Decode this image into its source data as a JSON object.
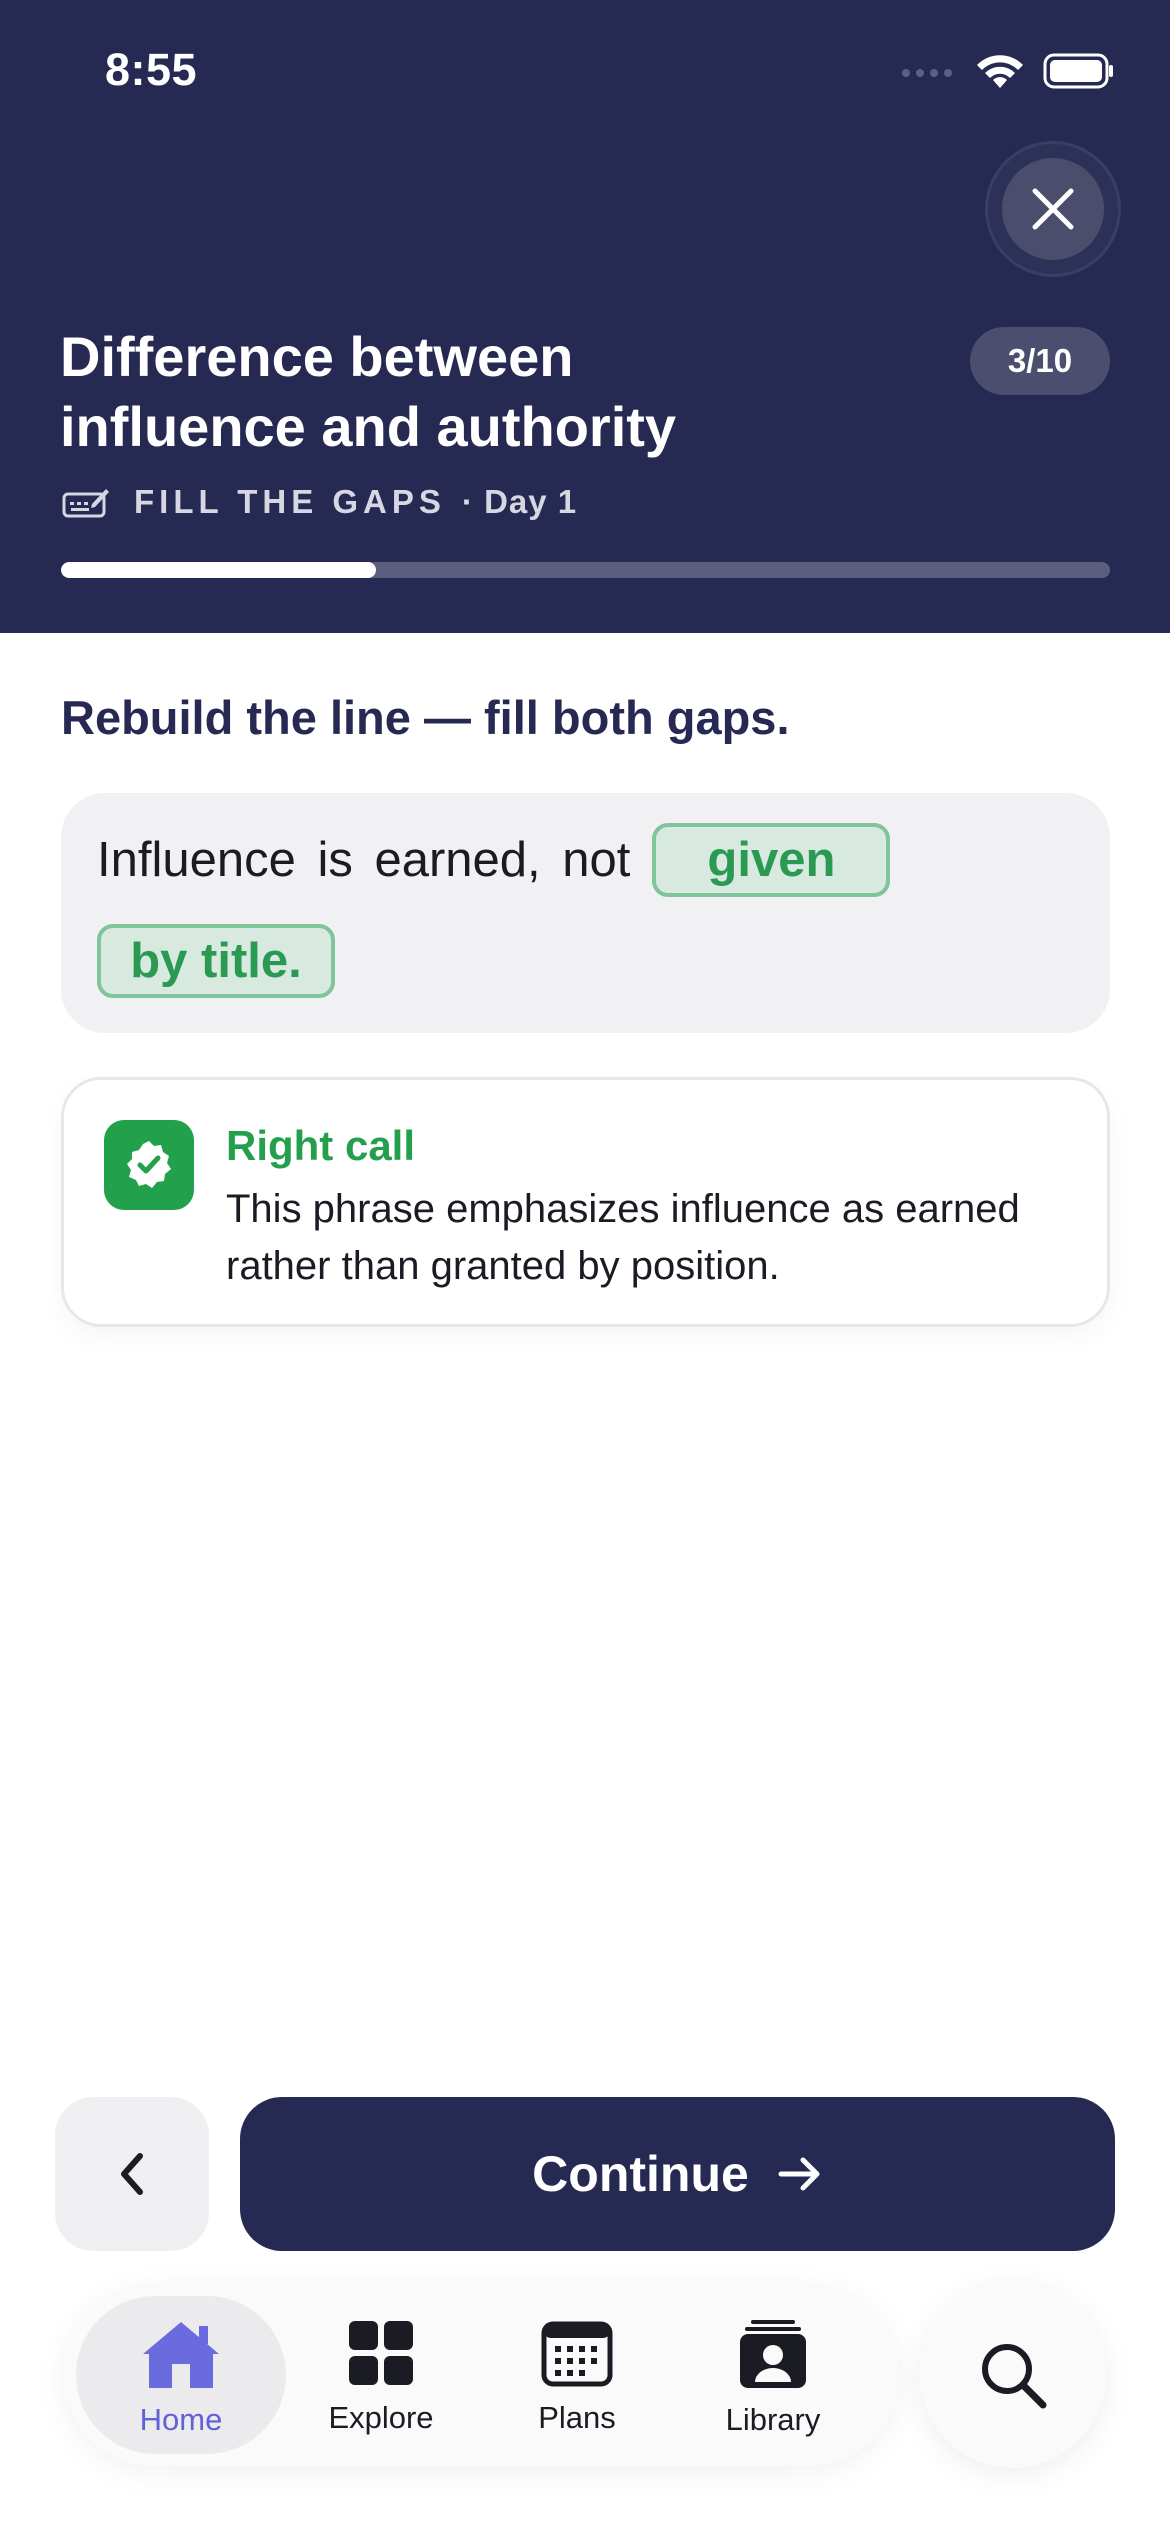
{
  "status_bar": {
    "time": "8:55"
  },
  "header": {
    "title_line1": "Difference between",
    "title_line2": "influence and authority",
    "progress_badge": "3/10",
    "mode_label": "FILL THE GAPS",
    "day_label": "· Day 1",
    "progress_fraction": 0.3
  },
  "exercise": {
    "instruction": "Rebuild the line — fill both gaps.",
    "sentence_prefix": "Influence is earned, not",
    "gap1": "given",
    "gap2": "by title."
  },
  "feedback": {
    "title": "Right call",
    "body": "This phrase emphasizes influence as earned rather than granted by position."
  },
  "actions": {
    "continue_label": "Continue"
  },
  "tabs": [
    {
      "label": "Home",
      "active": true
    },
    {
      "label": "Explore",
      "active": false
    },
    {
      "label": "Plans",
      "active": false
    },
    {
      "label": "Library",
      "active": false
    }
  ],
  "colors": {
    "header_bg": "#262952",
    "success_green": "#24a04c",
    "active_tab": "#6262d6"
  }
}
